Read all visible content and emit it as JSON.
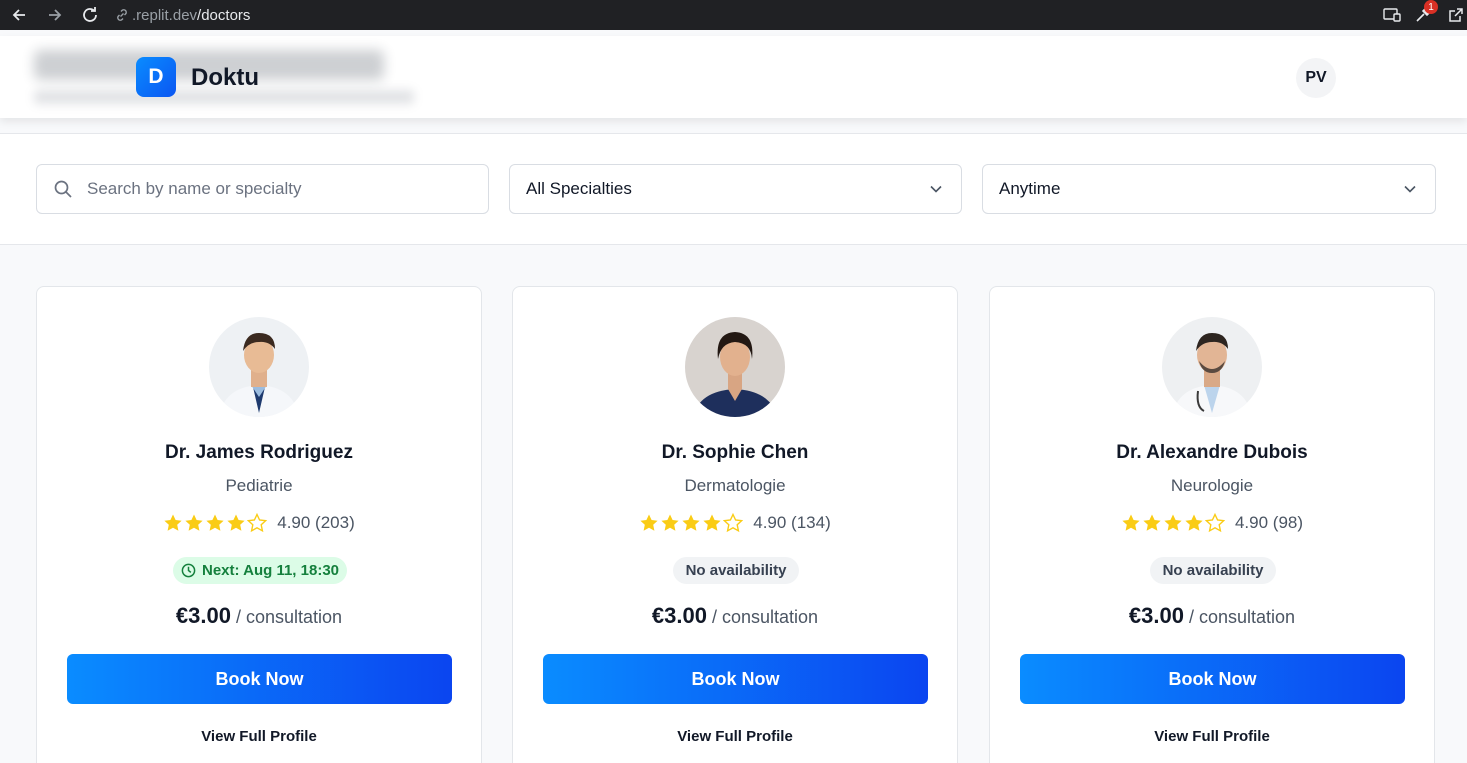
{
  "browser": {
    "url_host": ".replit.dev",
    "url_path": "/doctors",
    "badge_count": "1"
  },
  "header": {
    "logo_letter": "D",
    "brand": "Doktu",
    "user_initials": "PV"
  },
  "filters": {
    "search_placeholder": "Search by name or specialty",
    "specialty_selected": "All Specialties",
    "time_selected": "Anytime"
  },
  "doctors": [
    {
      "name": "Dr. James Rodriguez",
      "specialty": "Pediatrie",
      "rating_stars": 4,
      "rating_text": "4.90 (203)",
      "availability": "Next: Aug 11, 18:30",
      "availability_type": "available",
      "price": "€3.00",
      "price_unit": " / consultation",
      "book_label": "Book Now",
      "profile_label": "View Full Profile"
    },
    {
      "name": "Dr. Sophie Chen",
      "specialty": "Dermatologie",
      "rating_stars": 4,
      "rating_text": "4.90 (134)",
      "availability": "No availability",
      "availability_type": "none",
      "price": "€3.00",
      "price_unit": " / consultation",
      "book_label": "Book Now",
      "profile_label": "View Full Profile"
    },
    {
      "name": "Dr. Alexandre Dubois",
      "specialty": "Neurologie",
      "rating_stars": 4,
      "rating_text": "4.90 (98)",
      "availability": "No availability",
      "availability_type": "none",
      "price": "€3.00",
      "price_unit": " / consultation",
      "book_label": "Book Now",
      "profile_label": "View Full Profile"
    }
  ],
  "colors": {
    "accent_start": "#0a8cff",
    "accent_end": "#0b45f0",
    "star": "#facc15",
    "available_bg": "#dcfce7",
    "available_text": "#15803d"
  }
}
